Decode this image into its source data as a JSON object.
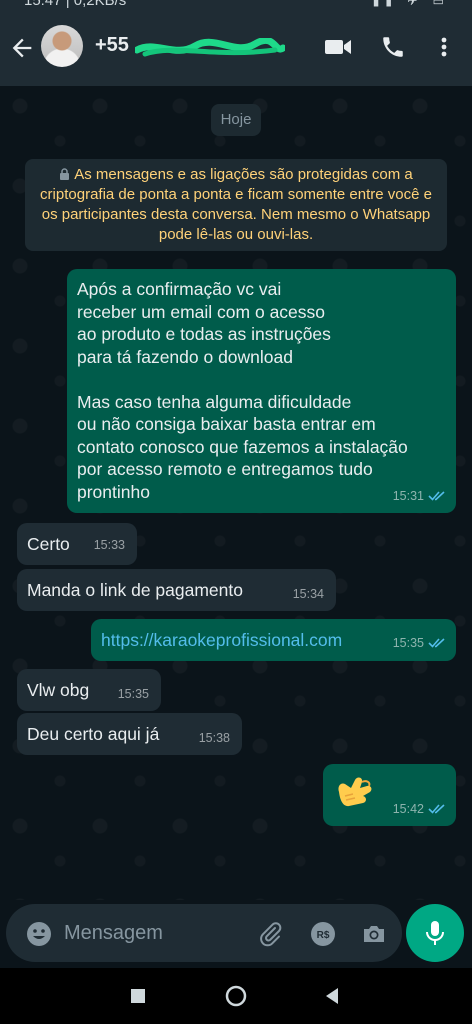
{
  "status_bar": {
    "text": "15:47 | 0,2KB/s"
  },
  "header": {
    "contact_name": "+55"
  },
  "chat": {
    "date_chip": "Hoje",
    "encryption_notice": "As mensagens e as ligações são protegidas com a criptografia de ponta a ponta e ficam somente entre você e os participantes desta conversa. Nem mesmo o Whatsapp pode lê-las ou ouvi-las.",
    "messages": [
      {
        "direction": "out",
        "text": "Após a confirmação vc vai\nreceber um email com o acesso\nao produto e  todas as instruções\npara tá fazendo o download\n\nMas caso tenha alguma dificuldade\nou não consiga baixar basta entrar em\ncontato conosco que fazemos a instalação\npor acesso remoto e entregamos tudo\nprontinho",
        "time": "15:31",
        "read": true
      },
      {
        "direction": "in",
        "text": "Certo",
        "time": "15:33"
      },
      {
        "direction": "in",
        "text": "Manda o link de pagamento",
        "time": "15:34"
      },
      {
        "direction": "out",
        "text": "https://karaokeprofissional.com",
        "time": "15:35",
        "read": true,
        "is_link": true
      },
      {
        "direction": "in",
        "text": "Vlw obg",
        "time": "15:35"
      },
      {
        "direction": "in",
        "text": "Deu certo aqui já",
        "time": "15:38"
      },
      {
        "direction": "out",
        "text": "",
        "emoji": "call-me-hand",
        "time": "15:42",
        "read": true
      }
    ]
  },
  "composer": {
    "placeholder": "Mensagem"
  },
  "colors": {
    "header_bg": "#1f2c34",
    "chat_bg": "#0b141a",
    "outgoing_bubble": "#005c4b",
    "incoming_bubble": "#1f2c34",
    "accent_green": "#00a884",
    "notice_text": "#ffd279",
    "link": "#53bdeb",
    "read_ticks": "#53bdeb"
  }
}
